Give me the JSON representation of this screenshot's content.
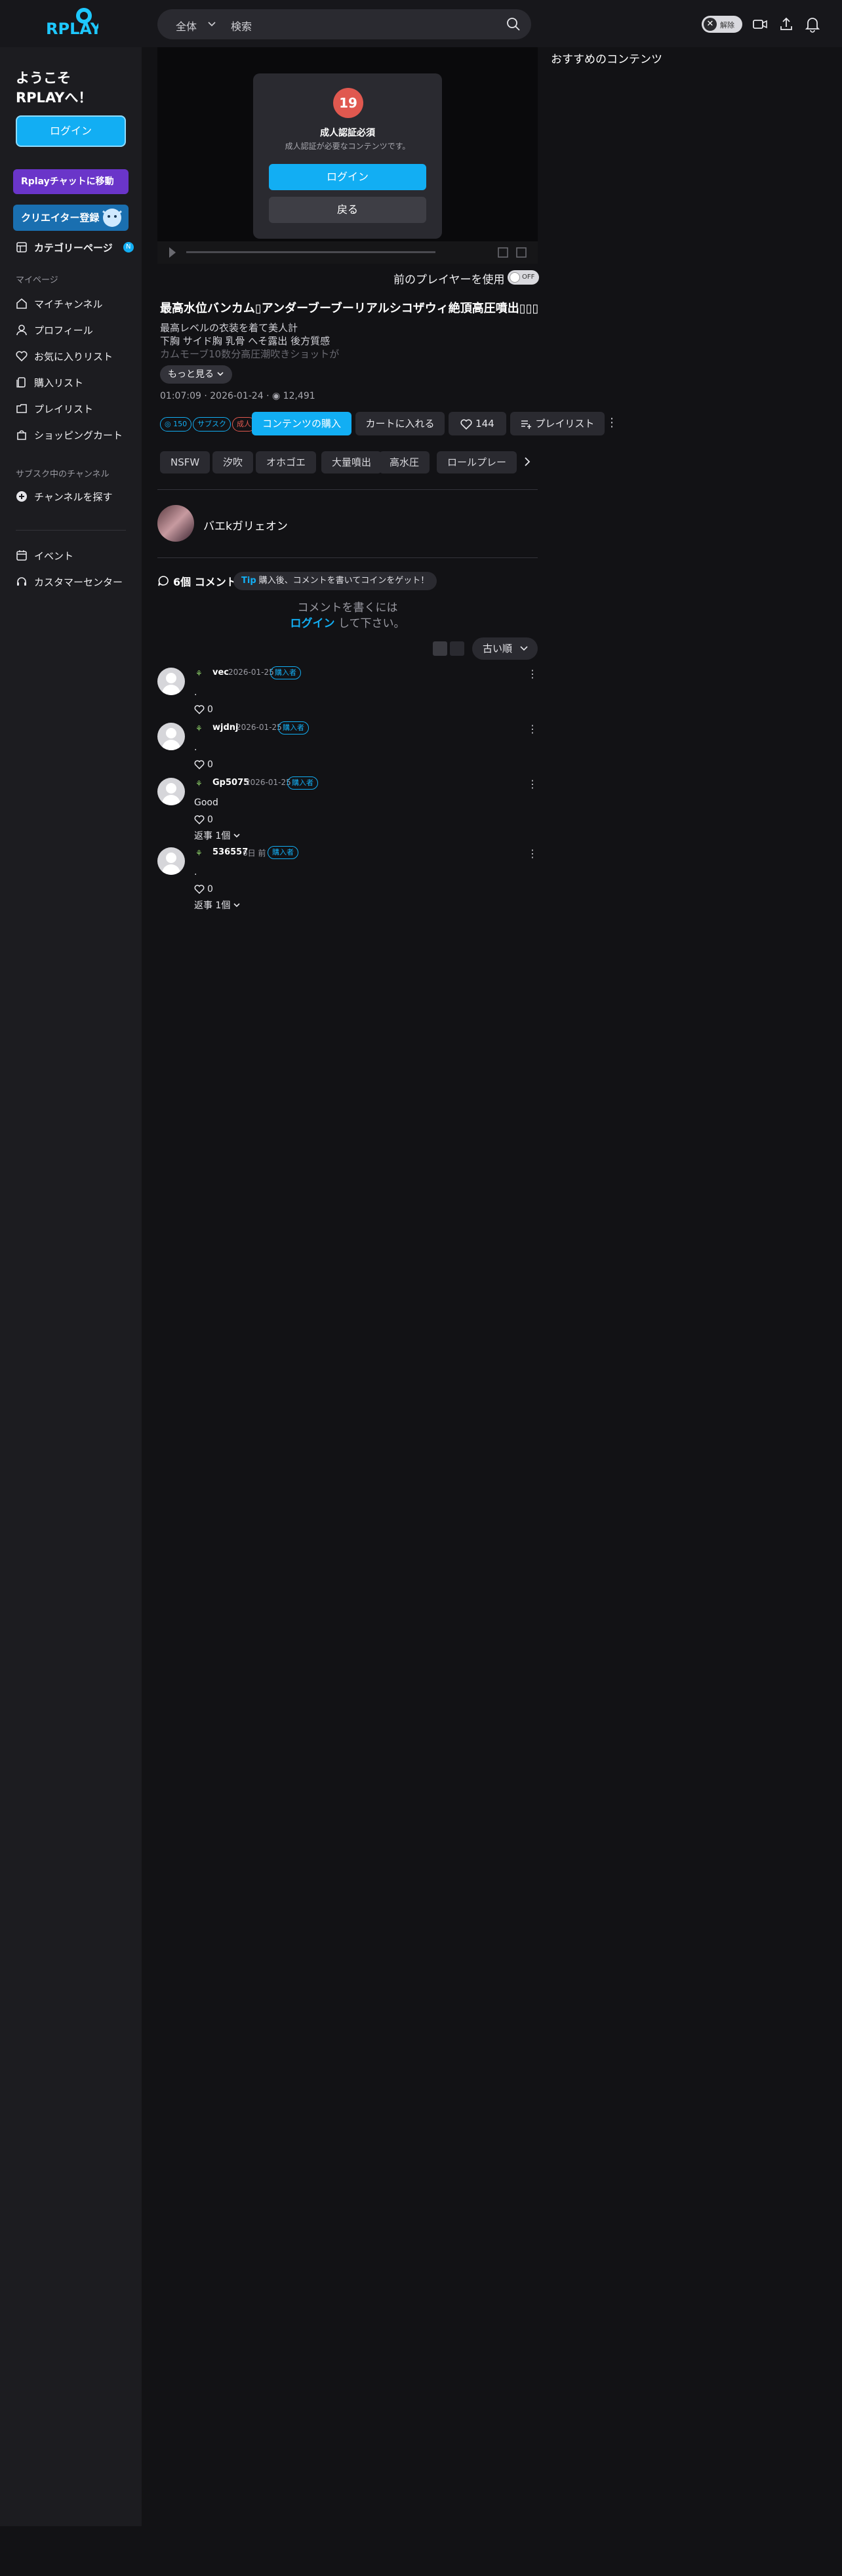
{
  "header": {
    "logo_text": "RPLAY",
    "search_scope": "全体",
    "search_placeholder": "検索",
    "adult_toggle_label": "解除",
    "adult_toggle_icon": "close-icon"
  },
  "sidebar": {
    "welcome_line1": "ようこそ",
    "welcome_line2": "RPLAYへ！",
    "login_label": "ログイン",
    "chat_label": "Rplayチャットに移動",
    "creator_label": "クリエイター登録",
    "category_label": "カテゴリーページ",
    "category_badge": "N",
    "mypage_section": "マイページ",
    "mypage_items": [
      {
        "label": "マイチャンネル",
        "icon": "home-icon"
      },
      {
        "label": "プロフィール",
        "icon": "user-icon"
      },
      {
        "label": "お気に入りリスト",
        "icon": "heart-icon"
      },
      {
        "label": "購入リスト",
        "icon": "receipt-icon"
      },
      {
        "label": "プレイリスト",
        "icon": "folder-icon"
      },
      {
        "label": "ショッピングカート",
        "icon": "bag-icon"
      }
    ],
    "subscribe_section": "サブスク中のチャンネル",
    "find_channel_label": "チャンネルを探す",
    "bottom_items": [
      {
        "label": "イベント",
        "icon": "calendar-icon"
      },
      {
        "label": "カスタマーセンター",
        "icon": "headset-icon"
      }
    ]
  },
  "age_modal": {
    "age": "19",
    "title": "成人認証必須",
    "subtitle": "成人認証が必要なコンテンツです。",
    "login_label": "ログイン",
    "back_label": "戻る"
  },
  "player": {
    "prev_player_label": "前のプレイヤーを使用",
    "toggle_state": "OFF"
  },
  "video": {
    "title": "最高水位バンカム▯アンダーブーブーリアルシコザウィ絶頂高圧噴出▯▯▯",
    "description_line1": "最高レベルの衣装を着て美人計",
    "description_line2": "下胸 サイド胸 乳骨 へそ露出 後方質感",
    "description_line3": "カムモーブ10数分高圧潮吹きショットが",
    "more_label": "もっと見る",
    "duration": "01:07:09",
    "date": "2026-01-24",
    "views": "12,491",
    "price_pill": "150",
    "subscribe_pill": "サブスク",
    "adult_pill": "成人",
    "buy_label": "コンテンツの購入",
    "cart_label": "カートに入れる",
    "likes": "144",
    "playlist_label": "プレイリスト",
    "tags": [
      "NSFW",
      "汐吹",
      "オホゴエ",
      "大量噴出",
      "高水圧",
      "ロールプレー"
    ]
  },
  "creator": {
    "name": "バエkガリェオン"
  },
  "comments_section": {
    "count_label": "6個 コメント",
    "tip_badge": "Tip",
    "tip_text": "購入後、コメントを書いてコインをゲット！",
    "login_prompt_line1": "コメントを書くには",
    "login_link": "ログイン",
    "login_prompt_line2_suffix": "して下さい。",
    "sort_label": "古い順"
  },
  "comments": [
    {
      "user": "vec",
      "date": "2026-01-25",
      "buyer": "購入者",
      "text": ".",
      "likes": "0",
      "reply": ""
    },
    {
      "user": "wjdnj",
      "date": "2026-01-25",
      "buyer": "購入者",
      "text": ".",
      "likes": "0",
      "reply": ""
    },
    {
      "user": "Gp5075",
      "date": "2026-01-25",
      "buyer": "購入者",
      "text": "Good",
      "likes": "0",
      "reply": "返事 1個"
    },
    {
      "user": "536557",
      "date": "6日 前",
      "buyer": "購入者",
      "text": ".",
      "likes": "0",
      "reply": "返事 1個"
    }
  ],
  "recommend": {
    "title": "おすすめのコンテンツ"
  },
  "colors": {
    "accent": "#12aef3",
    "age_badge": "#e0584f",
    "chat_button": "#6a35c9",
    "creator_button": "#1a6fb0"
  }
}
